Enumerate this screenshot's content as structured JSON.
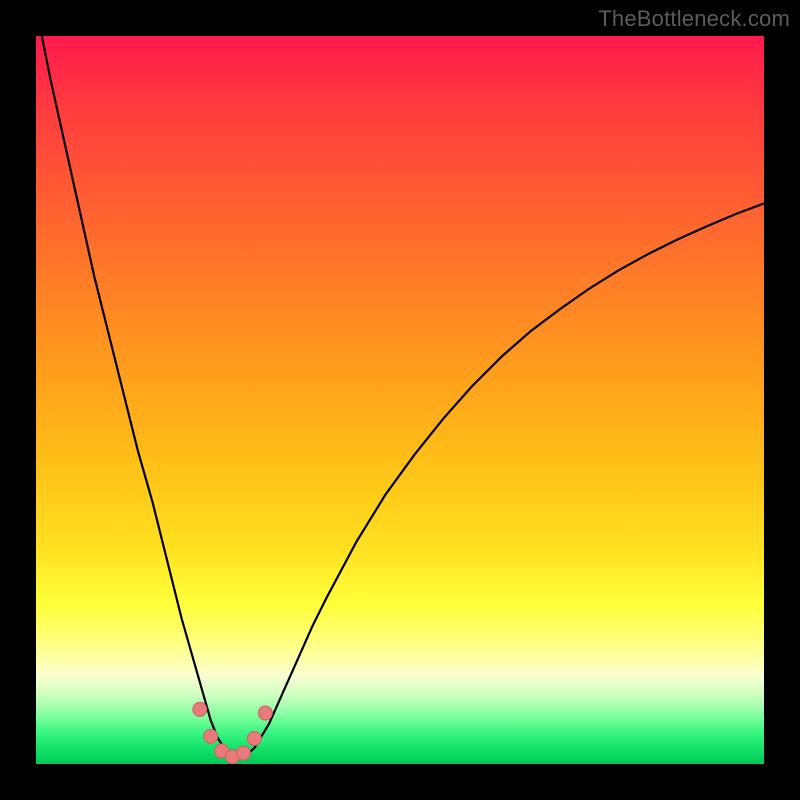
{
  "watermark": "TheBottleneck.com",
  "colors": {
    "frame": "#000000",
    "gradient_top": "#ff1a4d",
    "gradient_bottom": "#03c957",
    "marker": "#e77a7a",
    "curve": "#000000"
  },
  "chart_data": {
    "type": "line",
    "title": "",
    "xlabel": "",
    "ylabel": "",
    "xlim": [
      0,
      100
    ],
    "ylim": [
      0,
      100
    ],
    "x": [
      0,
      2,
      4,
      6,
      8,
      10,
      12,
      14,
      16,
      18,
      20,
      21,
      22,
      23,
      24,
      25,
      26,
      27,
      28,
      29,
      30,
      32,
      34,
      36,
      38,
      40,
      44,
      48,
      52,
      56,
      60,
      64,
      68,
      72,
      76,
      80,
      84,
      88,
      92,
      96,
      100
    ],
    "values": [
      104,
      94,
      85,
      76,
      67,
      59,
      51,
      43,
      36,
      28,
      20,
      16.5,
      13,
      9.5,
      6,
      3.5,
      2,
      1.2,
      1,
      1.3,
      2.2,
      5.5,
      10,
      14.5,
      19,
      23,
      30.5,
      37,
      42.5,
      47.5,
      52,
      56,
      59.5,
      62.5,
      65.3,
      67.8,
      70,
      72,
      73.8,
      75.5,
      77
    ],
    "markers": {
      "x": [
        22.5,
        24.0,
        25.5,
        27.0,
        28.5,
        30.0,
        31.5
      ],
      "y": [
        7.5,
        3.8,
        1.8,
        1.0,
        1.5,
        3.5,
        7.0
      ]
    }
  }
}
